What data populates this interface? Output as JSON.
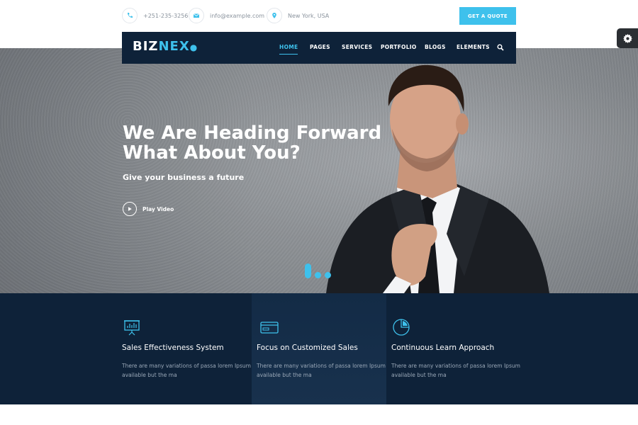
{
  "topbar": {
    "phone": "+251-235-3256",
    "email": "info@example.com",
    "location": "New York, USA",
    "quote_button": "GET A QUOTE"
  },
  "nav": {
    "logo_main": "BIZ",
    "logo_accent": "NEX",
    "items": [
      {
        "label": "HOME",
        "active": true
      },
      {
        "label": "PAGES"
      },
      {
        "label": "SERVICES"
      },
      {
        "label": "PORTFOLIO"
      },
      {
        "label": "BLOGS"
      },
      {
        "label": "ELEMENTS"
      }
    ]
  },
  "hero": {
    "title_line1": "We Are Heading Forward",
    "title_line2": "What About You?",
    "subtitle": "Give your business a future",
    "play_label": "Play Video",
    "slides_total": 3,
    "active_slide": 1
  },
  "features": [
    {
      "icon": "presentation-chart-icon",
      "title": "Sales Effectiveness System",
      "desc": "There are many variations of passa lorem Ipsum available but the ma"
    },
    {
      "icon": "credit-card-icon",
      "title": "Focus on Customized Sales",
      "desc": "There are many variations of passa lorem Ipsum available but the ma"
    },
    {
      "icon": "pie-chart-icon",
      "title": "Continuous Learn Approach",
      "desc": "There are many variations of passa lorem Ipsum available but the ma"
    }
  ],
  "colors": {
    "accent": "#3ec1ec",
    "navy": "#0e2239"
  }
}
